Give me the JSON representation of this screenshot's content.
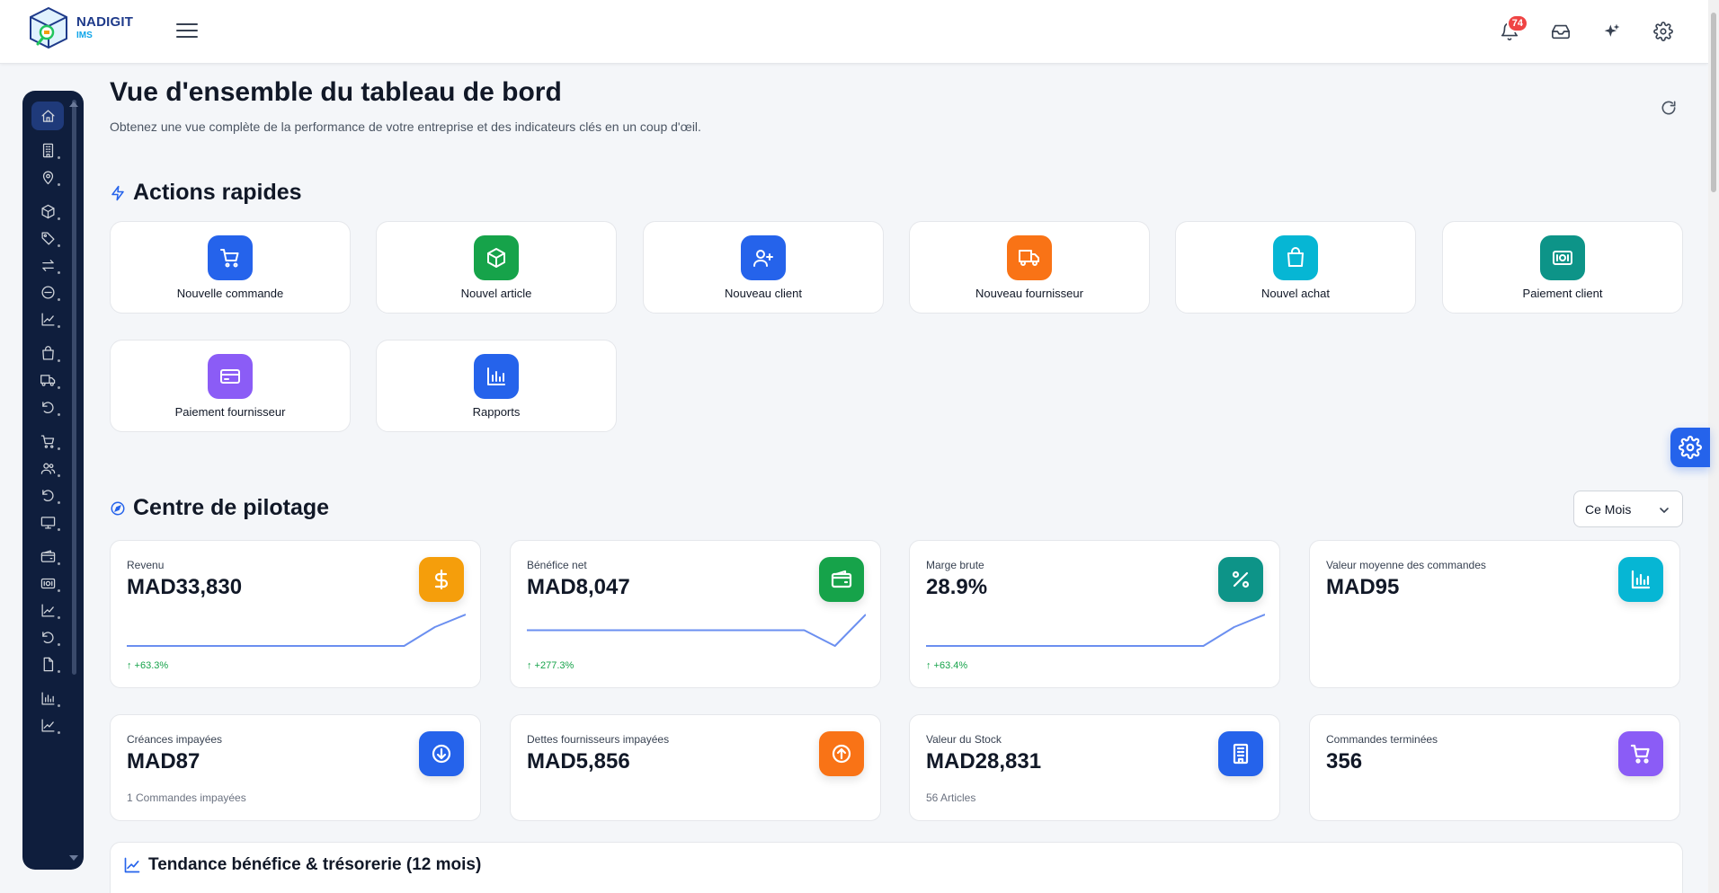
{
  "brand": {
    "name": "NADIGIT",
    "sub": "IMS"
  },
  "topbar": {
    "notification_count": "74"
  },
  "page": {
    "title": "Vue d'ensemble du tableau de bord",
    "subtitle": "Obtenez une vue complète de la performance de votre entreprise et des indicateurs clés en un coup d'œil."
  },
  "quick_actions": {
    "title": "Actions rapides",
    "items": [
      {
        "label": "Nouvelle commande",
        "icon": "cart-icon",
        "color": "#2563eb"
      },
      {
        "label": "Nouvel article",
        "icon": "box-icon",
        "color": "#16a34a"
      },
      {
        "label": "Nouveau client",
        "icon": "user-plus-icon",
        "color": "#2563eb"
      },
      {
        "label": "Nouveau fournisseur",
        "icon": "truck-icon",
        "color": "#f97316"
      },
      {
        "label": "Nouvel achat",
        "icon": "shopping-bag-icon",
        "color": "#06b6d4"
      },
      {
        "label": "Paiement client",
        "icon": "cash-icon",
        "color": "#0d9488"
      },
      {
        "label": "Paiement fournisseur",
        "icon": "credit-card-icon",
        "color": "#8b5cf6"
      },
      {
        "label": "Rapports",
        "icon": "bar-chart-icon",
        "color": "#2563eb"
      }
    ]
  },
  "cockpit": {
    "title": "Centre de pilotage",
    "period": "Ce Mois",
    "kpis": [
      {
        "label": "Revenu",
        "value": "MAD33,830",
        "delta": "↑ +63.3%",
        "icon": "dollar-icon",
        "color": "#f59e0b",
        "spark": [
          0,
          0,
          0,
          0,
          0,
          0,
          0,
          0,
          0,
          0,
          0.6,
          1
        ]
      },
      {
        "label": "Bénéfice net",
        "value": "MAD8,047",
        "delta": "↑ +277.3%",
        "icon": "wallet-icon",
        "color": "#16a34a",
        "spark": [
          0.5,
          0.5,
          0.5,
          0.5,
          0.5,
          0.5,
          0.5,
          0.5,
          0.5,
          0.5,
          0,
          1
        ]
      },
      {
        "label": "Marge brute",
        "value": "28.9%",
        "delta": "↑ +63.4%",
        "icon": "percent-icon",
        "color": "#0d9488",
        "spark": [
          0,
          0,
          0,
          0,
          0,
          0,
          0,
          0,
          0,
          0,
          0.6,
          1
        ]
      },
      {
        "label": "Valeur moyenne des commandes",
        "value": "MAD95",
        "icon": "bar-chart-icon",
        "color": "#06b6d4"
      }
    ],
    "stats": [
      {
        "label": "Créances impayées",
        "value": "MAD87",
        "note": "1 Commandes impayées",
        "icon": "arrow-down-circle-icon",
        "color": "#2563eb"
      },
      {
        "label": "Dettes fournisseurs impayées",
        "value": "MAD5,856",
        "note": "",
        "icon": "arrow-up-circle-icon",
        "color": "#f97316"
      },
      {
        "label": "Valeur du Stock",
        "value": "MAD28,831",
        "note": "56 Articles",
        "icon": "building-icon",
        "color": "#2563eb"
      },
      {
        "label": "Commandes terminées",
        "value": "356",
        "note": "",
        "icon": "cart-icon",
        "color": "#8b5cf6"
      }
    ]
  },
  "trend": {
    "title": "Tendance bénéfice & trésorerie (12 mois)"
  },
  "sidebar": {
    "items": [
      "home-icon",
      "building-icon",
      "map-pin-icon",
      "box-icon",
      "tag-icon",
      "transfer-icon",
      "minus-circle-icon",
      "trend-icon",
      "shopping-bag-icon",
      "truck-icon",
      "undo-icon",
      "cart-icon",
      "users-icon",
      "undo-icon",
      "monitor-icon",
      "wallet-icon",
      "cash-icon",
      "trend-icon",
      "undo-icon",
      "file-icon",
      "bar-chart-icon",
      "trend-icon"
    ]
  }
}
